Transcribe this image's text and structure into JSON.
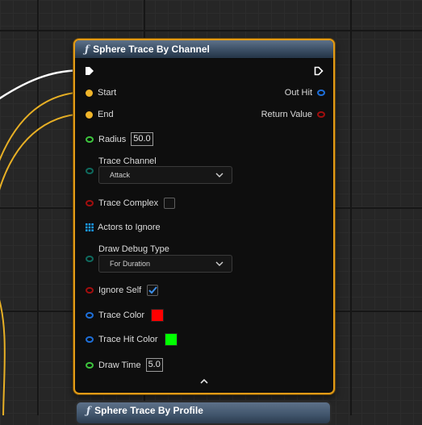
{
  "node": {
    "title": "Sphere Trace By Channel",
    "icon": "function-icon",
    "inputs": {
      "start": "Start",
      "end": "End",
      "radius": {
        "label": "Radius",
        "value": "50.0"
      },
      "trace_channel": {
        "label": "Trace Channel",
        "value": "Attack"
      },
      "trace_complex": {
        "label": "Trace Complex",
        "checked": false
      },
      "actors_to_ignore": "Actors to Ignore",
      "draw_debug_type": {
        "label": "Draw Debug Type",
        "value": "For Duration"
      },
      "ignore_self": {
        "label": "Ignore Self",
        "checked": true
      },
      "trace_color": {
        "label": "Trace Color",
        "color": "#ff0000"
      },
      "trace_hit_color": {
        "label": "Trace Hit Color",
        "color": "#00ff00"
      },
      "draw_time": {
        "label": "Draw Time",
        "value": "5.0"
      }
    },
    "outputs": {
      "out_hit": "Out Hit",
      "return_value": "Return Value"
    }
  },
  "next_node": {
    "title": "Sphere Trace By Profile"
  },
  "colors": {
    "selection_border": "#e39b16",
    "exec_wire": "#ffffff",
    "vector_pin": "#f0b52a",
    "float_pin": "#3dc43d",
    "struct_pin": "#1e6fd9",
    "bool_pin": "#a10e0e",
    "byte_pin": "#0f6a5e",
    "object_array_pin": "#1aa0ff"
  }
}
